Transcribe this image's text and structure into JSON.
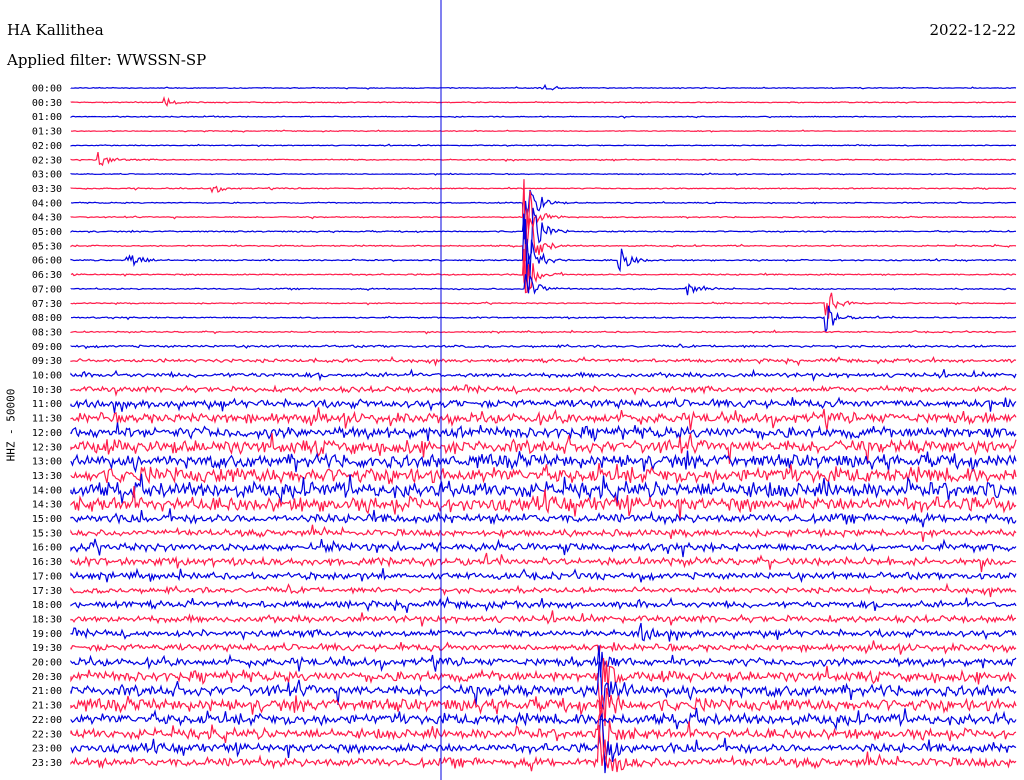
{
  "header": {
    "station": "HA Kallithea",
    "filter": "Applied filter: WWSSN-SP",
    "date": "2022-12-22",
    "channel": "HHZ - 50000"
  },
  "colors": {
    "even": "#0000e0",
    "odd": "#ff1b4a"
  },
  "chart_data": {
    "type": "line",
    "ylabel": "HHZ - 50000",
    "x_minutes_per_line": 30,
    "tick_labels": [
      "00:00",
      "00:30",
      "01:00",
      "01:30",
      "02:00",
      "02:30",
      "03:00",
      "03:30",
      "04:00",
      "04:30",
      "05:00",
      "05:30",
      "06:00",
      "06:30",
      "07:00",
      "07:30",
      "08:00",
      "08:30",
      "09:00",
      "09:30",
      "10:00",
      "10:30",
      "11:00",
      "11:30",
      "12:00",
      "12:30",
      "13:00",
      "13:30",
      "14:00",
      "14:30",
      "15:00",
      "15:30",
      "16:00",
      "16:30",
      "17:00",
      "17:30",
      "18:00",
      "18:30",
      "19:00",
      "19:30",
      "20:00",
      "20:30",
      "21:00",
      "21:30",
      "22:00",
      "22:30",
      "23:00",
      "23:30"
    ],
    "noise_level": [
      0.4,
      0.4,
      0.4,
      0.4,
      0.4,
      0.5,
      0.4,
      0.5,
      0.5,
      0.5,
      0.6,
      0.6,
      0.6,
      0.6,
      0.6,
      0.5,
      0.6,
      0.6,
      1.0,
      1.5,
      2.0,
      2.5,
      3.5,
      4.5,
      5.0,
      6.0,
      6.0,
      7.0,
      7.0,
      6.5,
      4.0,
      3.0,
      3.5,
      3.5,
      3.0,
      2.5,
      3.0,
      3.0,
      3.0,
      3.0,
      3.5,
      4.5,
      5.0,
      5.5,
      5.0,
      4.5,
      4.0,
      4.0
    ],
    "events": [
      {
        "line": 0,
        "at": 0.5,
        "amp": 5
      },
      {
        "line": 1,
        "at": 0.1,
        "amp": 4
      },
      {
        "line": 5,
        "at": 0.03,
        "amp": 8
      },
      {
        "line": 7,
        "at": 0.15,
        "amp": 5
      },
      {
        "line": 8,
        "at": 0.48,
        "amp": 40
      },
      {
        "line": 9,
        "at": 0.48,
        "amp": 50
      },
      {
        "line": 10,
        "at": 0.48,
        "amp": 60
      },
      {
        "line": 11,
        "at": 0.48,
        "amp": 50
      },
      {
        "line": 12,
        "at": 0.48,
        "amp": 45
      },
      {
        "line": 12,
        "at": 0.06,
        "amp": 14
      },
      {
        "line": 12,
        "at": 0.58,
        "amp": 15
      },
      {
        "line": 13,
        "at": 0.48,
        "amp": 30
      },
      {
        "line": 14,
        "at": 0.48,
        "amp": 25
      },
      {
        "line": 14,
        "at": 0.65,
        "amp": 8
      },
      {
        "line": 15,
        "at": 0.8,
        "amp": 18
      },
      {
        "line": 16,
        "at": 0.8,
        "amp": 15
      },
      {
        "line": 38,
        "at": 0.6,
        "amp": 10
      },
      {
        "line": 40,
        "at": 0.56,
        "amp": 15
      },
      {
        "line": 41,
        "at": 0.56,
        "amp": 30
      },
      {
        "line": 42,
        "at": 0.56,
        "amp": 40
      },
      {
        "line": 43,
        "at": 0.56,
        "amp": 30
      },
      {
        "line": 45,
        "at": 0.56,
        "amp": 35
      },
      {
        "line": 46,
        "at": 0.56,
        "amp": 40
      },
      {
        "line": 47,
        "at": 0.56,
        "amp": 40
      }
    ]
  }
}
